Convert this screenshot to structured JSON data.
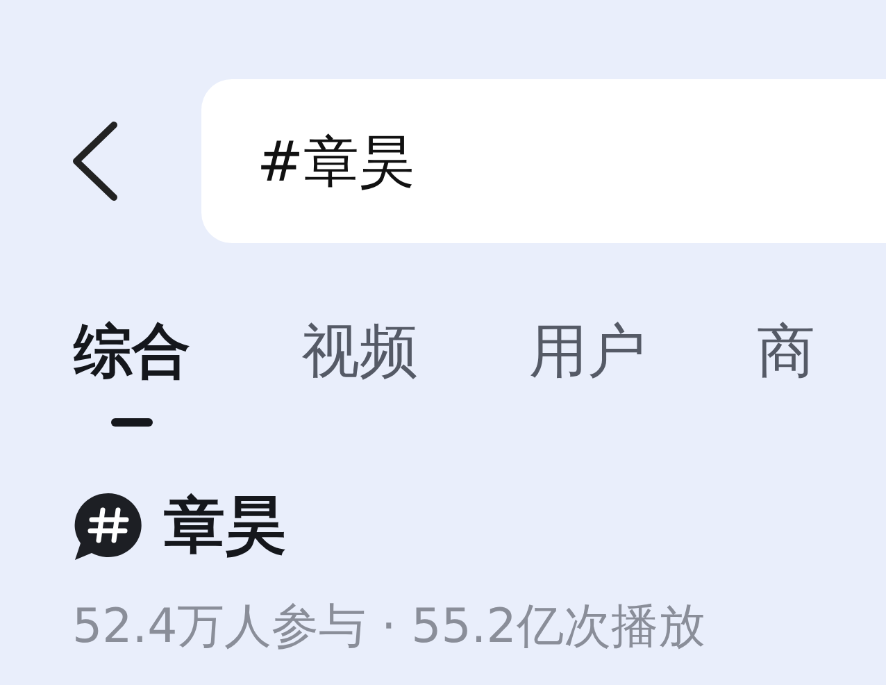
{
  "search": {
    "value": "#章昊"
  },
  "tabs": [
    {
      "label": "综合",
      "selected": true
    },
    {
      "label": "视频",
      "selected": false
    },
    {
      "label": "用户",
      "selected": false
    },
    {
      "label": "商",
      "selected": false
    }
  ],
  "topic": {
    "title": "章昊",
    "stats": "52.4万人参与 · 55.2亿次播放"
  }
}
